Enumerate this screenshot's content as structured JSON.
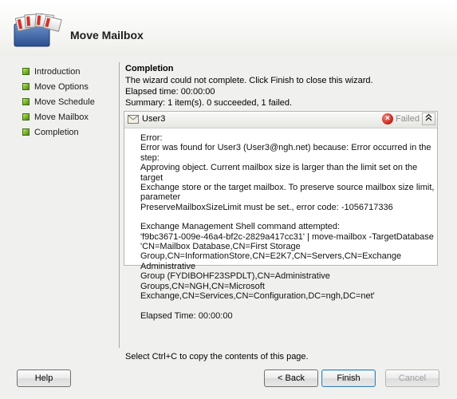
{
  "header": {
    "title": "Move Mailbox",
    "icon": "mailbox-wizard-icon"
  },
  "steps": [
    {
      "label": "Introduction"
    },
    {
      "label": "Move Options"
    },
    {
      "label": "Move Schedule"
    },
    {
      "label": "Move Mailbox"
    },
    {
      "label": "Completion"
    }
  ],
  "content": {
    "title": "Completion",
    "message": "The wizard could not complete. Click Finish to close this wizard.",
    "elapsed": "Elapsed time: 00:00:00",
    "summary": "Summary: 1 item(s). 0 succeeded, 1 failed."
  },
  "result": {
    "user": "User3",
    "status": "Failed",
    "collapse_glyph": "≈",
    "error_lines": [
      "Error:",
      "Error was found for User3 (User3@ngh.net) because: Error occurred in the step:",
      "Approving object. Current mailbox size is larger than the limit set on the target",
      "Exchange store or the target mailbox. To preserve source mailbox size limit, parameter",
      "PreserveMailboxSizeLimit must be set., error code: -1056717336"
    ],
    "command_lines": [
      "Exchange Management Shell command attempted:",
      "'f9bc3671-009e-46a4-bf2c-2829a417cc31' | move-mailbox -TargetDatabase",
      "'CN=Mailbox Database,CN=First Storage",
      "Group,CN=InformationStore,CN=E2K7,CN=Servers,CN=Exchange Administrative",
      "Group (FYDIBOHF23SPDLT),CN=Administrative Groups,CN=NGH,CN=Microsoft",
      "Exchange,CN=Services,CN=Configuration,DC=ngh,DC=net'"
    ],
    "elapsed": "Elapsed Time: 00:00:00"
  },
  "footer_note": "Select Ctrl+C to copy the contents of this page.",
  "buttons": {
    "help": "Help",
    "back": "< Back",
    "finish": "Finish",
    "cancel": "Cancel"
  }
}
